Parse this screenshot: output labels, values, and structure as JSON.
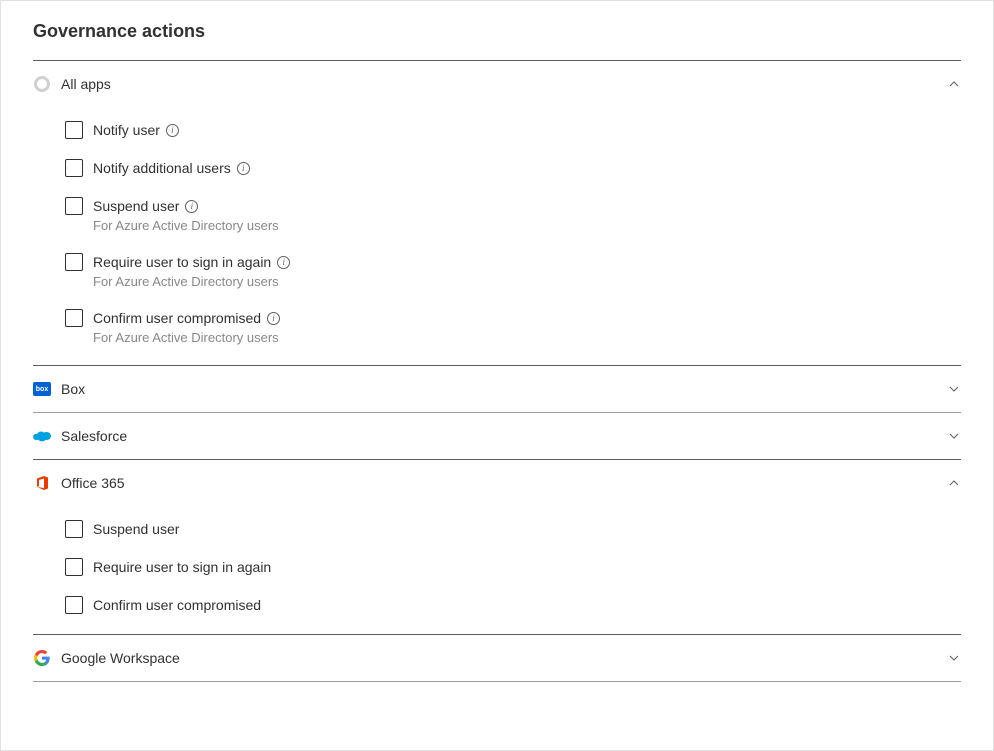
{
  "title": "Governance actions",
  "sections": [
    {
      "id": "all-apps",
      "label": "All apps",
      "expanded": true,
      "items": [
        {
          "label": "Notify user",
          "info": true
        },
        {
          "label": "Notify additional users",
          "info": true
        },
        {
          "label": "Suspend user",
          "info": true,
          "subtext": "For Azure Active Directory users"
        },
        {
          "label": "Require user to sign in again",
          "info": true,
          "subtext": "For Azure Active Directory users"
        },
        {
          "label": "Confirm user compromised",
          "info": true,
          "subtext": "For Azure Active Directory users"
        }
      ]
    },
    {
      "id": "box",
      "label": "Box",
      "expanded": false
    },
    {
      "id": "salesforce",
      "label": "Salesforce",
      "expanded": false
    },
    {
      "id": "office-365",
      "label": "Office 365",
      "expanded": true,
      "items": [
        {
          "label": "Suspend user"
        },
        {
          "label": "Require user to sign in again"
        },
        {
          "label": "Confirm user compromised"
        }
      ]
    },
    {
      "id": "google-workspace",
      "label": "Google Workspace",
      "expanded": false
    }
  ]
}
